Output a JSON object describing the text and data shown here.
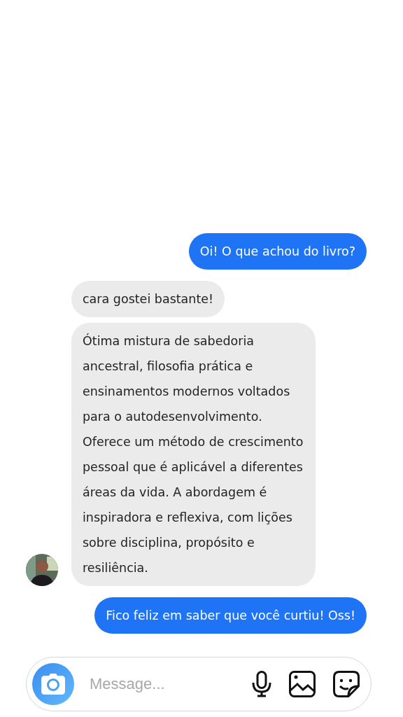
{
  "messages": [
    {
      "kind": "outgoing",
      "text": "Oi! O que achou do livro?",
      "show_avatar": false
    },
    {
      "kind": "incoming",
      "text": "cara gostei bastante!",
      "show_avatar": false
    },
    {
      "kind": "incoming",
      "text": "Ótima mistura de sabedoria ancestral, filosofia prática e ensinamentos modernos voltados para o autodesenvolvimento. Oferece um método de crescimento pessoal que é aplicável a diferentes áreas da vida. A abordagem é inspiradora e reflexiva, com lições sobre disciplina, propósito e resiliência.",
      "show_avatar": true
    },
    {
      "kind": "outgoing",
      "text": "Fico feliz em saber que você curtiu! Oss!",
      "show_avatar": false
    }
  ],
  "composer": {
    "placeholder": "Message..."
  }
}
